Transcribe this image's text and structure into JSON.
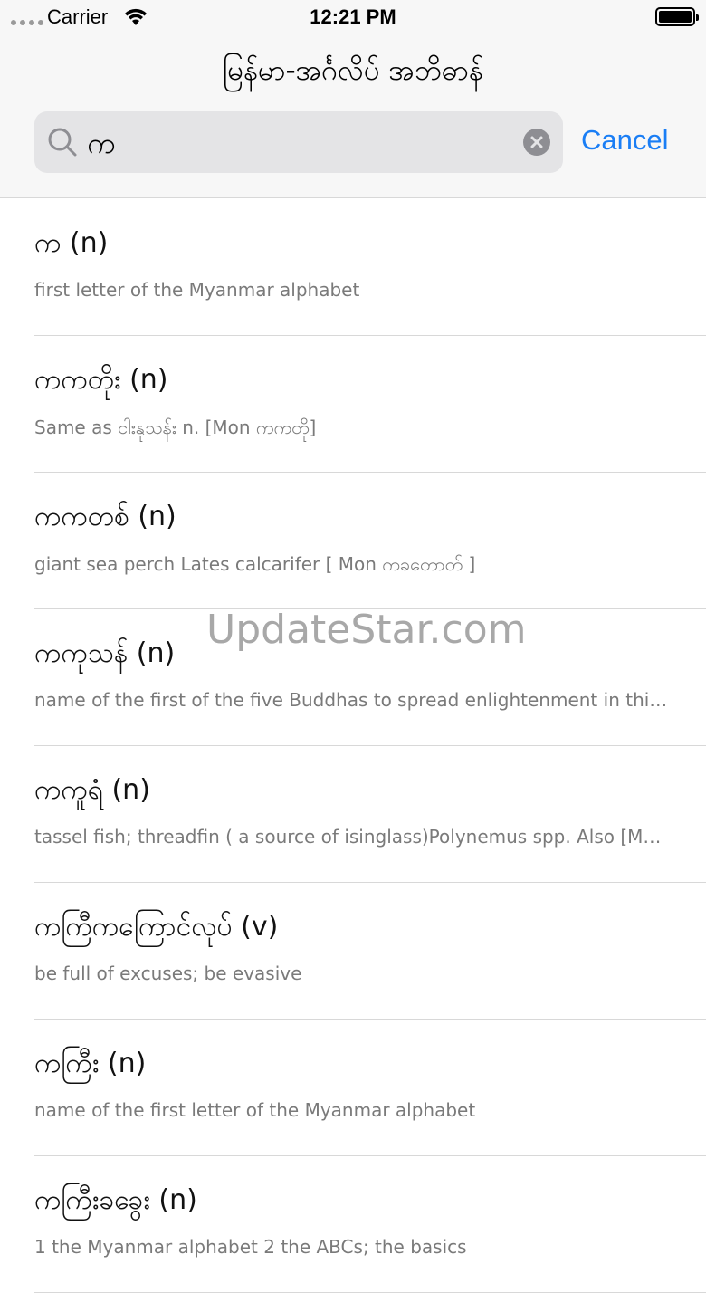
{
  "status_bar": {
    "carrier": "Carrier",
    "time": "12:21 PM"
  },
  "header": {
    "title": "မြန်မာ-အင်္ဂလိပ် အဘိဓာန်"
  },
  "search": {
    "value": "က",
    "cancel_label": "Cancel"
  },
  "entries": [
    {
      "term": "က (n)",
      "definition": "first letter of the Myanmar alphabet"
    },
    {
      "term": "ကကတိုး (n)",
      "definition": "Same as ငါးနုသန်း n.  [Mon ကကတို]"
    },
    {
      "term": "ကကတစ် (n)",
      "definition": "giant  sea  perch Lates calcarifer [ Mon ကခတောတ် ]"
    },
    {
      "term": "ကကုသန် (n)",
      "definition": "name  of  the first  of the five Buddhas to spread enlightenment in this..."
    },
    {
      "term": "ကကူရံ (n)",
      "definition": "tassel  fish;  threadfin  ( a source of isinglass)Polynemus spp. Also [My..."
    },
    {
      "term": "ကကြီကကြောင်လုပ် (v)",
      "definition": "be full of excuses; be evasive"
    },
    {
      "term": "ကကြီး (n)",
      "definition": "name of the first letter of the Myanmar alphabet"
    },
    {
      "term": "ကကြီးခခွေး (n)",
      "definition": "1 the Myanmar alphabet   2 the ABCs; the basics"
    }
  ],
  "watermark": "UpdateStar.com",
  "colors": {
    "accent": "#1a7ef5",
    "nav_background": "#f7f7f7",
    "search_field": "#e4e4e6",
    "secondary_text": "#7a7a7a"
  }
}
